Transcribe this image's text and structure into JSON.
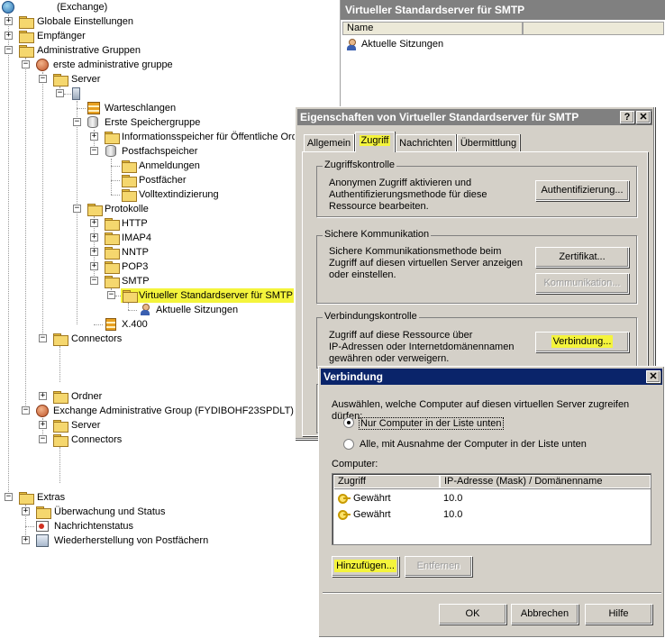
{
  "tree": {
    "root": "(Exchange)",
    "globale": "Globale Einstellungen",
    "empfaenger": "Empfänger",
    "admin_gruppen": "Administrative Gruppen",
    "erste_gruppe": "erste administrative gruppe",
    "server": "Server",
    "warteschlangen": "Warteschlangen",
    "erste_speicher": "Erste Speichergruppe",
    "info_speicher": "Informationsspeicher für Öffentliche Ord",
    "postfach_speicher": "Postfachspeicher",
    "anmeldungen": "Anmeldungen",
    "postfaecher": "Postfächer",
    "volltext": "Volltextindizierung",
    "protokolle": "Protokolle",
    "http": "HTTP",
    "imap4": "IMAP4",
    "nntp": "NNTP",
    "pop3": "POP3",
    "smtp": "SMTP",
    "virt_smtp": "Virtueller Standardserver für SMTP",
    "aktuelle": "Aktuelle Sitzungen",
    "x400": "X.400",
    "connectors": "Connectors",
    "ordner": "Ordner",
    "exch_admin": "Exchange Administrative Group (FYDIBOHF23SPDLT)",
    "server2": "Server",
    "connectors2": "Connectors",
    "extras": "Extras",
    "ueberwachung": "Überwachung und Status",
    "nachrichtenstatus": "Nachrichtenstatus",
    "wiederherstellung": "Wiederherstellung von Postfächern"
  },
  "panel": {
    "title": "Virtueller Standardserver für SMTP",
    "col_name": "Name",
    "item": "Aktuelle Sitzungen"
  },
  "props": {
    "title": "Eigenschaften von Virtueller Standardserver für SMTP",
    "help": "?",
    "close": "✕",
    "tabs": [
      "Allgemein",
      "Zugriff",
      "Nachrichten",
      "Übermittlung"
    ],
    "zugriff_label": "Zugriffskontrolle",
    "zugriff_text": [
      "Anonymen Zugriff aktivieren und",
      "Authentifizierungsmethode für diese",
      "Ressource bearbeiten."
    ],
    "auth_btn": "Authentifizierung...",
    "sicher_label": "Sichere Kommunikation",
    "sicher_text": [
      "Sichere Kommunikationsmethode beim",
      "Zugriff auf diesen virtuellen Server anzeigen",
      "oder einstellen."
    ],
    "zert_btn": "Zertifikat...",
    "komm_btn": "Kommunikation...",
    "verb_label": "Verbindungskontrolle",
    "verb_text": [
      "Zugriff auf diese Ressource über",
      "IP-Adressen oder Internetdomänennamen",
      "gewähren oder verweigern."
    ],
    "verb_btn": "Verbindung..."
  },
  "verbindung": {
    "title": "Verbindung",
    "close": "✕",
    "prompt": "Auswählen, welche Computer auf diesen virtuellen Server zugreifen dürfen:",
    "radio1": "Nur Computer in der Liste unten",
    "radio2": "Alle, mit Ausnahme der Computer in der Liste unten",
    "computer_label": "Computer:",
    "col_zugriff": "Zugriff",
    "col_ip": "IP-Adresse (Mask) / Domänenname",
    "rows": [
      {
        "zugriff": "Gewährt",
        "ip": "10.0"
      },
      {
        "zugriff": "Gewährt",
        "ip": "10.0"
      }
    ],
    "add_btn": "Hinzufügen...",
    "remove_btn": "Entfernen",
    "ok": "OK",
    "cancel": "Abbrechen",
    "help": "Hilfe"
  },
  "colors": {
    "highlight": "#f4f43c",
    "active_title": "#0a246a",
    "inactive_title": "#808080"
  },
  "icons": [
    "exchange-icon",
    "folder-icon",
    "admin-group-icon",
    "server-icon",
    "queue-icon",
    "storage-group-icon",
    "key-icon",
    "user-icon",
    "close-icon",
    "help-icon"
  ]
}
